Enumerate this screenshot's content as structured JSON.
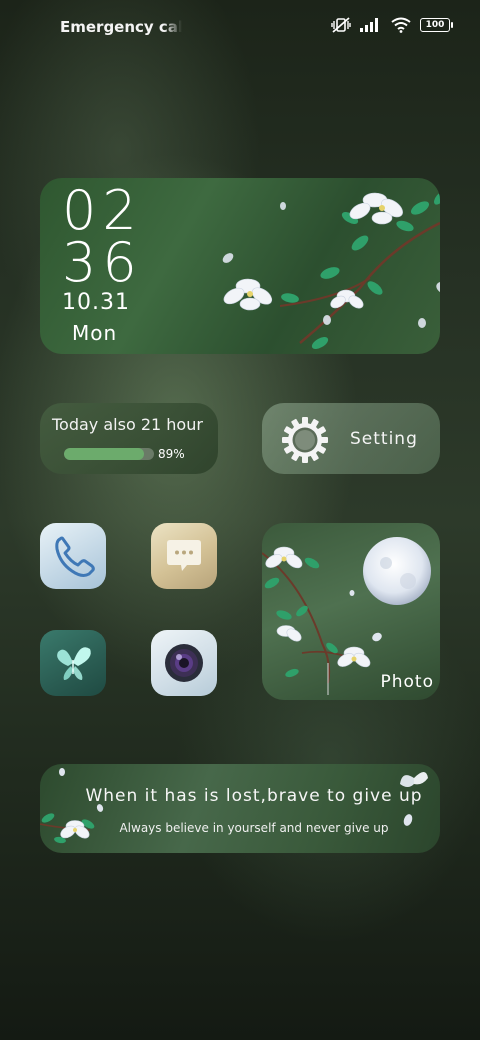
{
  "status_bar": {
    "carrier_text": "Emergency calls only",
    "icons": [
      "mute-vibrate-icon",
      "signal-icon",
      "wifi-icon",
      "battery-icon"
    ],
    "battery_level": "100"
  },
  "clock_widget": {
    "hour": "02",
    "minute": "36",
    "date": "10.31",
    "day": "Mon"
  },
  "usage_widget": {
    "label": "Today also 21 hour",
    "progress_percent": 89,
    "progress_text": "89%",
    "bar_color": "#6cab6c"
  },
  "setting_widget": {
    "label": "Setting",
    "icon": "gear-icon"
  },
  "apps": [
    {
      "name": "phone",
      "icon": "phone-icon"
    },
    {
      "name": "messages",
      "icon": "message-icon"
    },
    {
      "name": "butterfly",
      "icon": "butterfly-icon"
    },
    {
      "name": "camera",
      "icon": "camera-icon"
    }
  ],
  "photo_widget": {
    "label": "Photo"
  },
  "quote_widget": {
    "main": "When it has is lost,brave to give up",
    "sub": "Always believe in yourself and never give up"
  }
}
